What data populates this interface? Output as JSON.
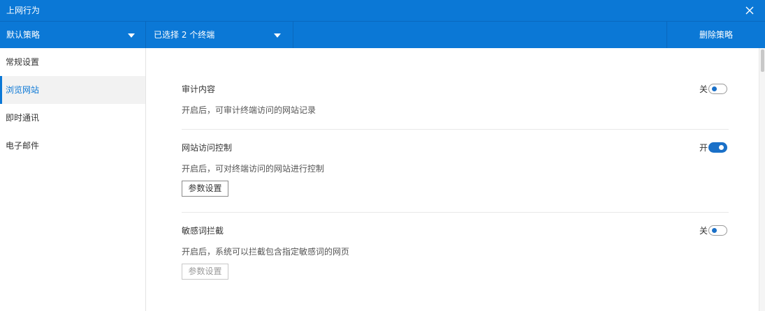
{
  "window": {
    "title": "上网行为",
    "close_icon": "close-icon"
  },
  "toolbar": {
    "policy_label": "默认策略",
    "terminals_label": "已选择 2 个终端",
    "delete_label": "删除策略"
  },
  "sidebar": {
    "items": [
      {
        "label": "常规设置",
        "active": false
      },
      {
        "label": "浏览网站",
        "active": true
      },
      {
        "label": "即时通讯",
        "active": false
      },
      {
        "label": "电子邮件",
        "active": false
      }
    ]
  },
  "sections": [
    {
      "title": "审计内容",
      "desc": "开启后，可审计终端访问的网站记录",
      "state_label": "关",
      "enabled": false
    },
    {
      "title": "网站访问控制",
      "desc": "开启后，可对终端访问的网站进行控制",
      "state_label": "开",
      "enabled": true,
      "button_label": "参数设置"
    },
    {
      "title": "敏感词拦截",
      "desc": "开启后，系统可以拦截包含指定敏感词的网页",
      "state_label": "关",
      "enabled": false,
      "button_label": "参数设置"
    }
  ],
  "colors": {
    "accent": "#0b78d6",
    "toggle": "#1a70c8"
  }
}
